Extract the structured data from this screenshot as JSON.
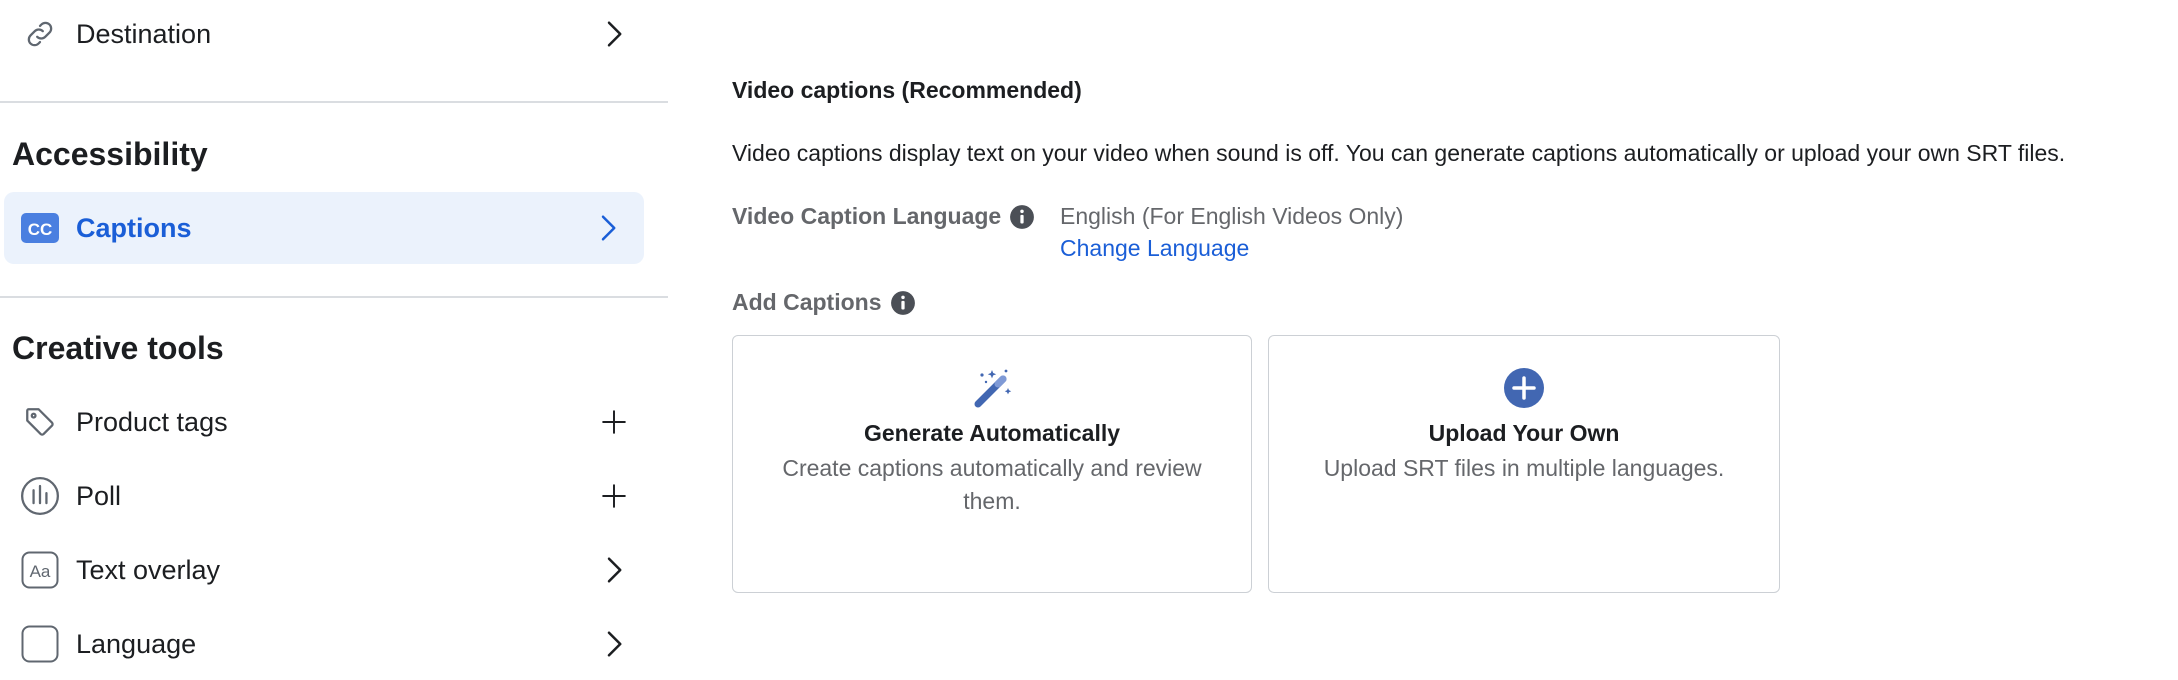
{
  "sidebar": {
    "destination": {
      "label": "Destination",
      "icon": "link-icon"
    },
    "accessibility": {
      "title": "Accessibility",
      "captions": {
        "label": "Captions",
        "icon": "cc-icon"
      }
    },
    "creative_tools": {
      "title": "Creative tools",
      "items": [
        {
          "label": "Product tags",
          "icon": "tag-icon",
          "action": "plus-icon"
        },
        {
          "label": "Poll",
          "icon": "poll-icon",
          "action": "plus-icon"
        },
        {
          "label": "Text overlay",
          "icon": "text-aa-icon",
          "action": "chevron-right-icon"
        },
        {
          "label": "Language",
          "icon": "image-icon",
          "action": "chevron-right-icon"
        }
      ]
    }
  },
  "main": {
    "heading": "Video captions (Recommended)",
    "description": "Video captions display text on your video when sound is off. You can generate captions automatically or upload your own SRT files.",
    "language_label": "Video Caption Language",
    "language_value": "English (For English Videos Only)",
    "change_language": "Change Language",
    "add_captions_label": "Add Captions",
    "cards": [
      {
        "title": "Generate Automatically",
        "description": "Create captions automatically and review them.",
        "icon": "magic-wand-icon"
      },
      {
        "title": "Upload Your Own",
        "description": "Upload SRT files in multiple languages.",
        "icon": "plus-circle-icon"
      }
    ]
  },
  "colors": {
    "accent": "#1a5ed7",
    "active_bg": "#ebf2fc",
    "icon_blue": "#4267b2",
    "text_gray": "#65676b"
  }
}
